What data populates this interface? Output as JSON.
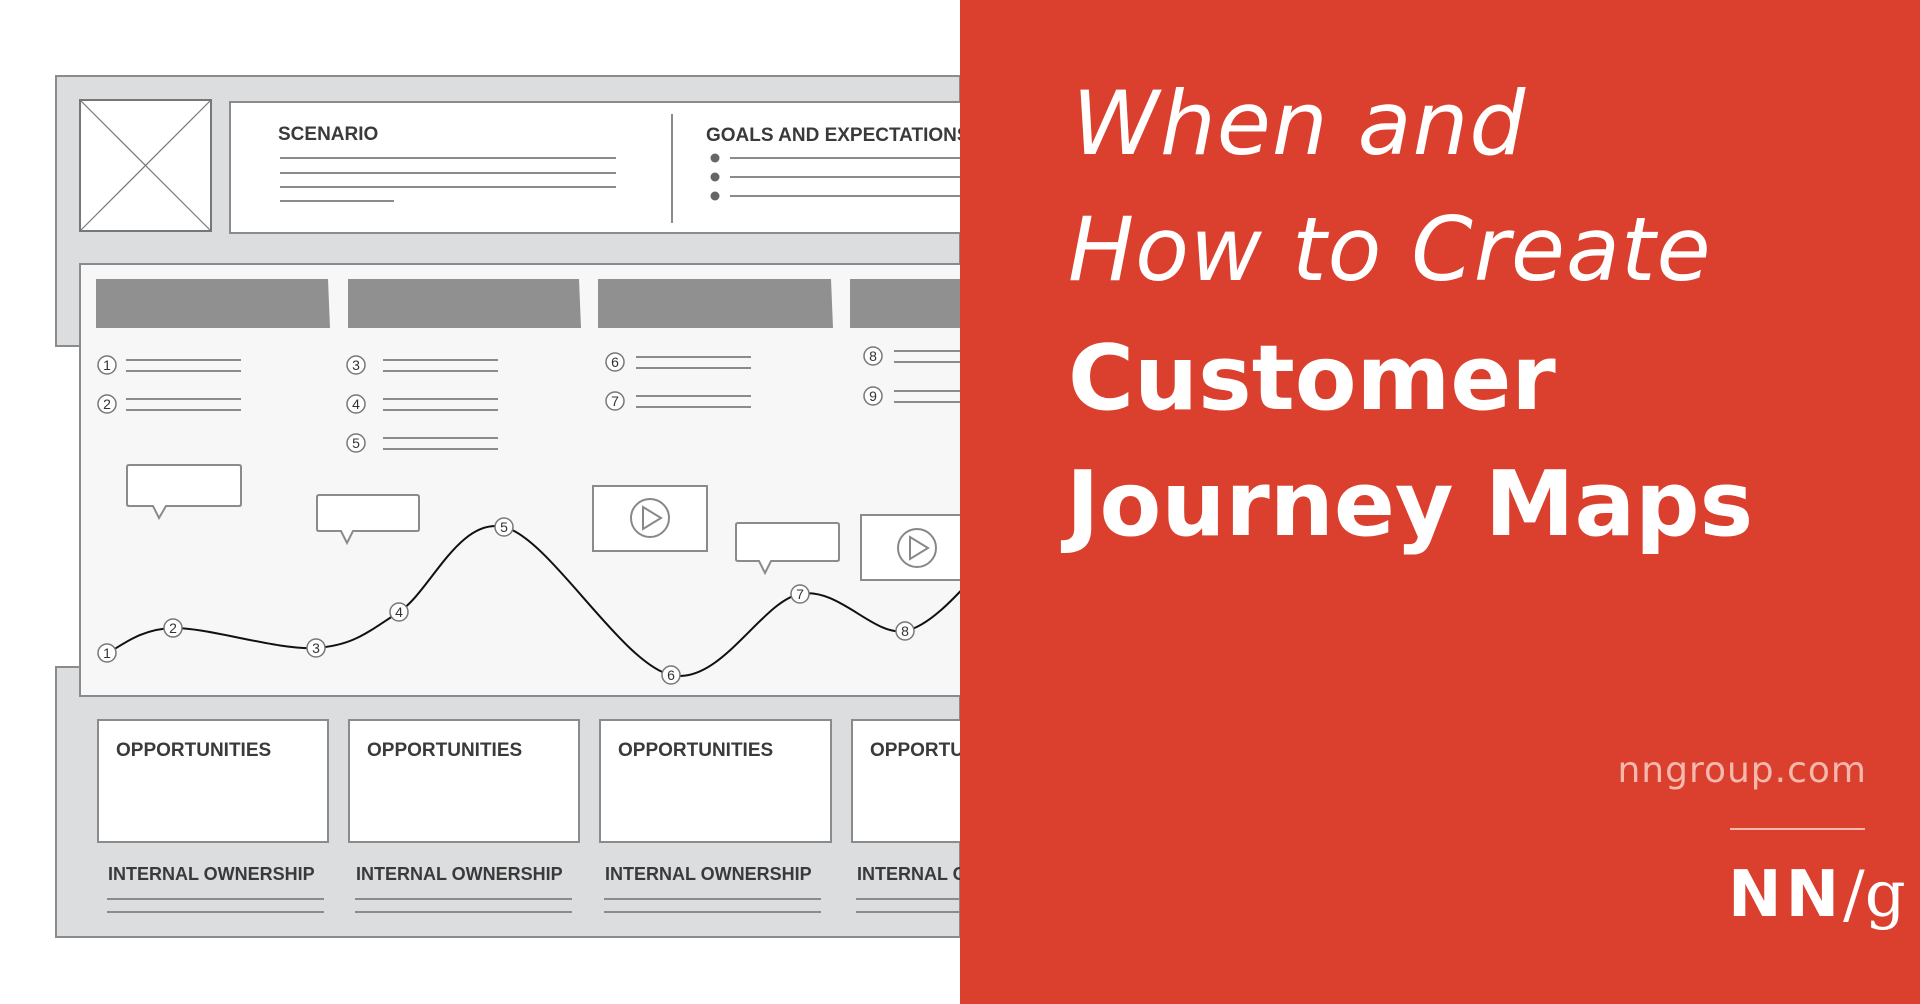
{
  "illustration": {
    "scenario_label": "SCENARIO",
    "goals_label": "GOALS AND EXPECTATIONS",
    "step_numbers": [
      "1",
      "2",
      "3",
      "4",
      "5",
      "6",
      "7",
      "8",
      "9"
    ],
    "curve_numbers": [
      "1",
      "2",
      "3",
      "4",
      "5",
      "6",
      "7",
      "8"
    ],
    "opportunities_label": "OPPORTUNITIES",
    "internal_ownership_label": "INTERNAL OWNERSHIP",
    "icons": [
      "image-placeholder-icon",
      "speech-bubble-icon",
      "play-video-icon"
    ]
  },
  "headline": {
    "line1": "When and",
    "line2": "How to Create",
    "line3": "Customer",
    "line4": "Journey Maps"
  },
  "site": "nngroup.com",
  "logo": {
    "nn": "NN",
    "slash": "/",
    "g": "g"
  },
  "colors": {
    "brand_red": "#db3f2d",
    "frame_gray": "#dcdddf",
    "header_gray": "#8f908f"
  }
}
